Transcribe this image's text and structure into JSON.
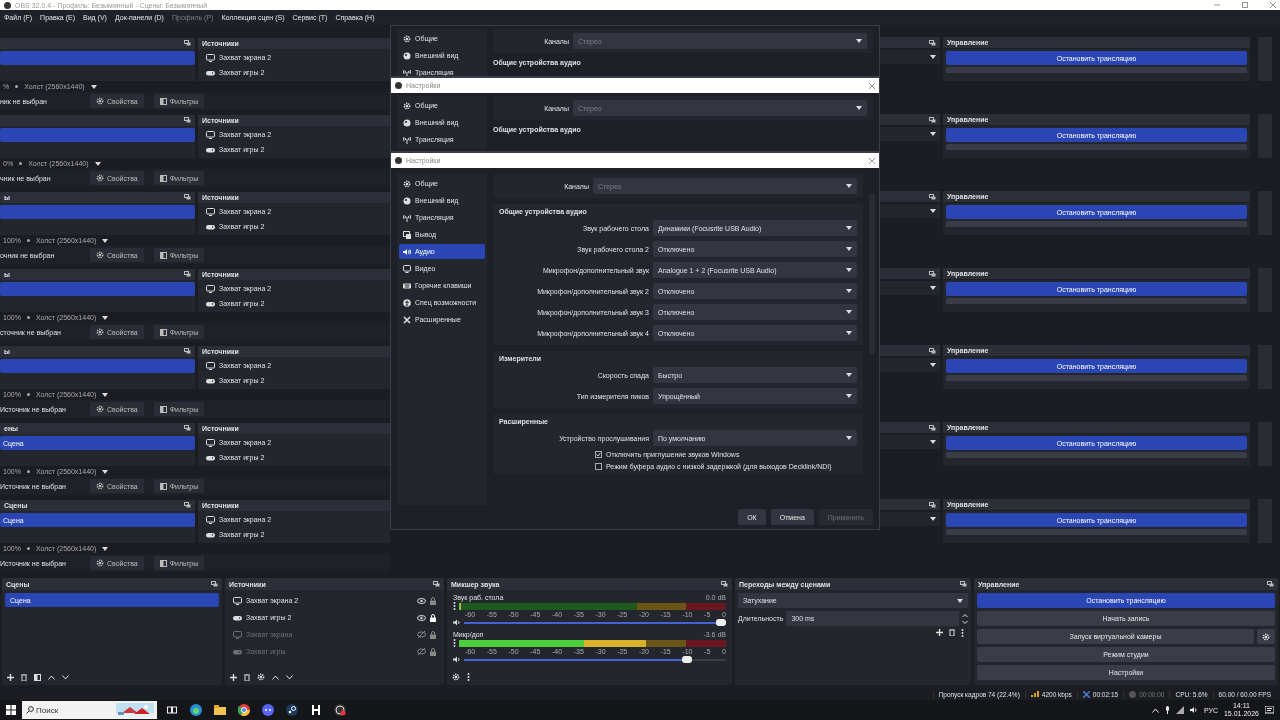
{
  "window": {
    "title": "OBS 32.0.4 - Профиль: Безымянный - Сцены: Безымянный"
  },
  "menu": [
    {
      "label": "Файл (F)",
      "disabled": false
    },
    {
      "label": "Правка (E)",
      "disabled": false
    },
    {
      "label": "Вид (V)",
      "disabled": false
    },
    {
      "label": "Док-панели (D)",
      "disabled": false
    },
    {
      "label": "Профиль (P)",
      "disabled": true
    },
    {
      "label": "Коллекция сцен (S)",
      "disabled": false
    },
    {
      "label": "Сервис (T)",
      "disabled": false
    },
    {
      "label": "Справка (H)",
      "disabled": false
    }
  ],
  "echoes": [
    {
      "sources_header": "Источники",
      "sources": [
        {
          "label": "Захват экрана 2",
          "kind": "display"
        },
        {
          "label": "Захват игры 2",
          "kind": "game"
        }
      ],
      "zoom": "%",
      "canvas": "Холст (2560x1440)",
      "selection": "ник не выбран",
      "properties": "Свойства",
      "filters": "Фильтры",
      "controls_header": "Управление",
      "stop": "Остановить трансляцию"
    },
    {
      "sources_header": "Источники",
      "sources": [
        {
          "label": "Захват экрана 2",
          "kind": "display"
        },
        {
          "label": "Захват игры 2",
          "kind": "game"
        }
      ],
      "zoom": "0%",
      "canvas": "Холст (2560x1440)",
      "selection": "чник не выбран",
      "properties": "Свойства",
      "filters": "Фильтры",
      "controls_header": "Управление",
      "stop": "Остановить трансляцию"
    },
    {
      "scenes_header": "ы",
      "sources_header": "Источники",
      "sources": [
        {
          "label": "Захват экрана 2",
          "kind": "display"
        },
        {
          "label": "Захват игры 2",
          "kind": "game"
        }
      ],
      "zoom": "100%",
      "canvas": "Холст (2560x1440)",
      "selection": "очник не выбран",
      "properties": "Свойства",
      "filters": "Фильтры",
      "controls_header": "Управление",
      "stop": "Остановить трансляцию"
    },
    {
      "scenes_header": "ы",
      "sources_header": "Источники",
      "sources": [
        {
          "label": "Захват экрана 2",
          "kind": "display"
        },
        {
          "label": "Захват игры 2",
          "kind": "game"
        }
      ],
      "zoom": "100%",
      "canvas": "Холст (2560x1440)",
      "selection": "сточник не выбран",
      "properties": "Свойства",
      "filters": "Фильтры",
      "controls_header": "Управление",
      "stop": "Остановить трансляцию"
    },
    {
      "scenes_header": "ы",
      "sources_header": "Источники",
      "sources": [
        {
          "label": "Захват экрана 2",
          "kind": "display"
        },
        {
          "label": "Захват игры 2",
          "kind": "game"
        }
      ],
      "zoom": "100%",
      "canvas": "Холст (2560x1440)",
      "selection": "Источник не выбран",
      "properties": "Свойства",
      "filters": "Фильтры",
      "controls_header": "Управление",
      "stop": "Остановить трансляцию"
    },
    {
      "scenes_header": "ены",
      "scene": "Сцена",
      "sources_header": "Источники",
      "sources": [
        {
          "label": "Захват экрана 2",
          "kind": "display"
        },
        {
          "label": "Захват игры 2",
          "kind": "game"
        }
      ],
      "zoom": "100%",
      "canvas": "Холст (2560x1440)",
      "selection": "Источник не выбран",
      "properties": "Свойства",
      "filters": "Фильтры",
      "controls_header": "Управление",
      "stop": "Остановить трансляцию"
    },
    {
      "scenes_header": "Сцены",
      "scene": "Сцена",
      "sources_header": "Источники",
      "sources": [
        {
          "label": "Захват экрана 2",
          "kind": "display"
        },
        {
          "label": "Захват игры 2",
          "kind": "game"
        }
      ],
      "zoom": "100%",
      "canvas": "Холст (2560x1440)",
      "selection": "Источник не выбран",
      "properties": "Свойства",
      "filters": "Фильтры",
      "controls_header": "Управление",
      "stop": "Остановить трансляцию"
    }
  ],
  "dialog_echoes": [
    {
      "sidebar": [
        "Общие",
        "Внешний вид",
        "Трансляция"
      ],
      "channels_label": "Каналы",
      "channels_value": "Стерео",
      "group": "Общие устройства аудио"
    },
    {
      "title": "Настройки",
      "sidebar": [
        "Общие",
        "Внешний вид",
        "Трансляция"
      ],
      "channels_label": "Каналы",
      "channels_value": "Стерео",
      "group": "Общие устройства аудио"
    }
  ],
  "settings": {
    "title": "Настройки",
    "sidebar": [
      {
        "label": "Общие",
        "selected": false
      },
      {
        "label": "Внешний вид",
        "selected": false
      },
      {
        "label": "Трансляция",
        "selected": false
      },
      {
        "label": "Вывод",
        "selected": false
      },
      {
        "label": "Аудио",
        "selected": true
      },
      {
        "label": "Видео",
        "selected": false
      },
      {
        "label": "Горячие клавиши",
        "selected": false
      },
      {
        "label": "Спец возможности",
        "selected": false
      },
      {
        "label": "Расширенные",
        "selected": false
      }
    ],
    "channels": {
      "label": "Каналы",
      "value": "Стерео",
      "disabled": true
    },
    "groups": [
      {
        "title": "Общие устройства аудио",
        "rows": [
          {
            "kind": "select",
            "label": "Звук рабочего стола",
            "value": "Динамики (Focusrite USB Audio)"
          },
          {
            "kind": "select",
            "label": "Звук рабочего стола 2",
            "value": "Отключено"
          },
          {
            "kind": "select",
            "label": "Микрофон/дополнительный звук",
            "value": "Analogue 1 + 2 (Focusrite USB Audio)"
          },
          {
            "kind": "select",
            "label": "Микрофон/дополнительный звук 2",
            "value": "Отключено"
          },
          {
            "kind": "select",
            "label": "Микрофон/дополнительный звук 3",
            "value": "Отключено"
          },
          {
            "kind": "select",
            "label": "Микрофон/дополнительный звук 4",
            "value": "Отключено"
          }
        ]
      },
      {
        "title": "Измерители",
        "rows": [
          {
            "kind": "select",
            "label": "Скорость спада",
            "value": "Быстро"
          },
          {
            "kind": "select",
            "label": "Тип измерителя пиков",
            "value": "Упрощённый"
          }
        ]
      },
      {
        "title": "Расширенные",
        "rows": [
          {
            "kind": "select",
            "label": "Устройство прослушивания",
            "value": "По умолчанию"
          },
          {
            "kind": "checkbox",
            "label": "Отключить приглушение звуков Windows",
            "checked": true
          },
          {
            "kind": "checkbox",
            "label": "Режим буфера аудио с низкой задержкой (для выходов Decklink/NDI)",
            "checked": false
          }
        ]
      }
    ],
    "buttons": [
      {
        "label": "ОК",
        "disabled": false
      },
      {
        "label": "Отмена",
        "disabled": false
      },
      {
        "label": "Применить",
        "disabled": true
      }
    ]
  },
  "dock": {
    "scenes": {
      "title": "Сцены",
      "items": [
        {
          "label": "Сцена",
          "selected": true
        }
      ]
    },
    "sources": {
      "title": "Источники",
      "items": [
        {
          "label": "Захват экрана 2",
          "kind": "display",
          "visible": true,
          "locked": false
        },
        {
          "label": "Захват игры 2",
          "kind": "game",
          "visible": true,
          "locked": true
        },
        {
          "label": "Захват экрана",
          "kind": "display",
          "visible": false,
          "locked": false
        },
        {
          "label": "Захват игры",
          "kind": "game",
          "visible": false,
          "locked": false
        }
      ]
    },
    "mixer": {
      "title": "Микшер звука",
      "channels": [
        {
          "name": "Звук раб. стола",
          "reading": "0.0 dB",
          "meter": {
            "level": 0
          },
          "volume": {
            "level": 1
          },
          "ticks": [
            "-60",
            "-55",
            "-50",
            "-45",
            "-40",
            "-35",
            "-30",
            "-25",
            "-20",
            "-15",
            "-10",
            "-5",
            "0"
          ]
        },
        {
          "name": "Микр/доп",
          "reading": "-3.6 dB",
          "meter": {
            "level": 0.7
          },
          "volume": {
            "level": 0.87
          },
          "ticks": [
            "-60",
            "-55",
            "-50",
            "-45",
            "-40",
            "-35",
            "-30",
            "-25",
            "-20",
            "-15",
            "-10",
            "-5",
            "0"
          ]
        }
      ]
    },
    "transitions": {
      "title": "Переходы между сценами",
      "transition": "Затухание",
      "duration_label": "Длительность",
      "duration": "300 ms"
    },
    "controls": {
      "title": "Управление",
      "buttons": [
        {
          "label": "Остановить трансляцию",
          "active": true
        },
        {
          "label": "Начать запись",
          "active": false
        },
        {
          "label": "Запуск виртуальной камеры",
          "active": false
        },
        {
          "label": "Режим студии",
          "active": false
        },
        {
          "label": "Настройки",
          "active": false
        }
      ]
    }
  },
  "status_bar": {
    "dropped": "Пропуск кадров 74 (22.4%)",
    "bitrate": "4200 kbps",
    "stream_time": "00:02:15",
    "record_time": "00:00:00",
    "cpu": "CPU: 5.6%",
    "fps": "60.00 / 60.00 FPS"
  },
  "taskbar": {
    "search_placeholder": "Поиск",
    "language": "РУС",
    "time": "14:11",
    "date": "15.01.2026"
  }
}
